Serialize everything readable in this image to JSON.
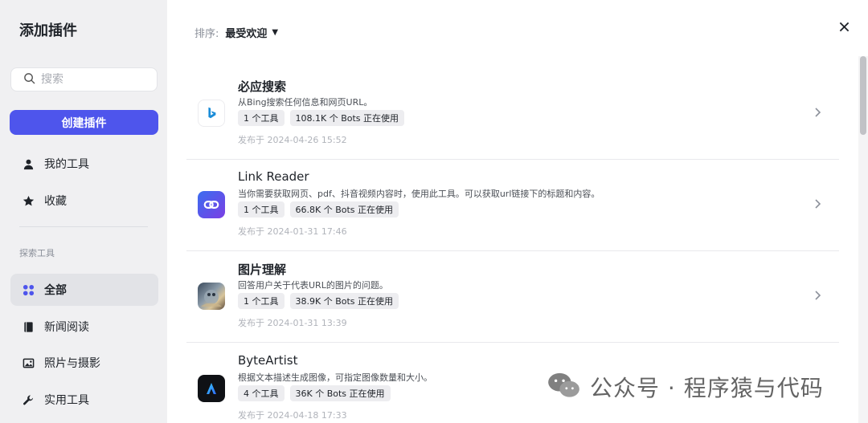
{
  "sidebar": {
    "title": "添加插件",
    "search_placeholder": "搜索",
    "create_label": "创建插件",
    "my_items": [
      {
        "label": "我的工具",
        "icon": "user-icon"
      },
      {
        "label": "收藏",
        "icon": "star-icon"
      }
    ],
    "explore_label": "探索工具",
    "categories": [
      {
        "label": "全部",
        "icon": "grid-icon",
        "active": true
      },
      {
        "label": "新闻阅读",
        "icon": "book-icon"
      },
      {
        "label": "照片与摄影",
        "icon": "image-icon"
      },
      {
        "label": "实用工具",
        "icon": "wrench-icon"
      }
    ]
  },
  "header": {
    "sort_label": "排序:",
    "sort_value": "最受欢迎",
    "close_icon": "close-icon"
  },
  "plugins": [
    {
      "name": "必应搜索",
      "desc": "从Bing搜索任何信息和网页URL。",
      "tools": "1 个工具",
      "bots": "108.1K 个 Bots 正在使用",
      "date": "发布于 2024-04-26 15:52",
      "icon": "bing-logo-icon"
    },
    {
      "name": "Link Reader",
      "desc": "当你需要获取网页、pdf、抖音视频内容时，使用此工具。可以获取url链接下的标题和内容。",
      "tools": "1 个工具",
      "bots": "66.8K 个 Bots 正在使用",
      "date": "发布于 2024-01-31 17:46",
      "icon": "link-icon"
    },
    {
      "name": "图片理解",
      "desc": "回答用户关于代表URL的图片的问题。",
      "tools": "1 个工具",
      "bots": "38.9K 个 Bots 正在使用",
      "date": "发布于 2024-01-31 13:39",
      "icon": "photo-thumbnail-icon"
    },
    {
      "name": "ByteArtist",
      "desc": "根据文本描述生成图像，可指定图像数量和大小。",
      "tools": "4 个工具",
      "bots": "36K 个 Bots 正在使用",
      "date": "发布于 2024-04-18 17:33",
      "icon": "byteartist-logo-icon"
    }
  ],
  "watermark": {
    "text": "公众号 · 程序猿与代码",
    "icon": "wechat-icon"
  },
  "colors": {
    "accent": "#4e55ec",
    "sidebar_bg": "#f0f0f2"
  }
}
